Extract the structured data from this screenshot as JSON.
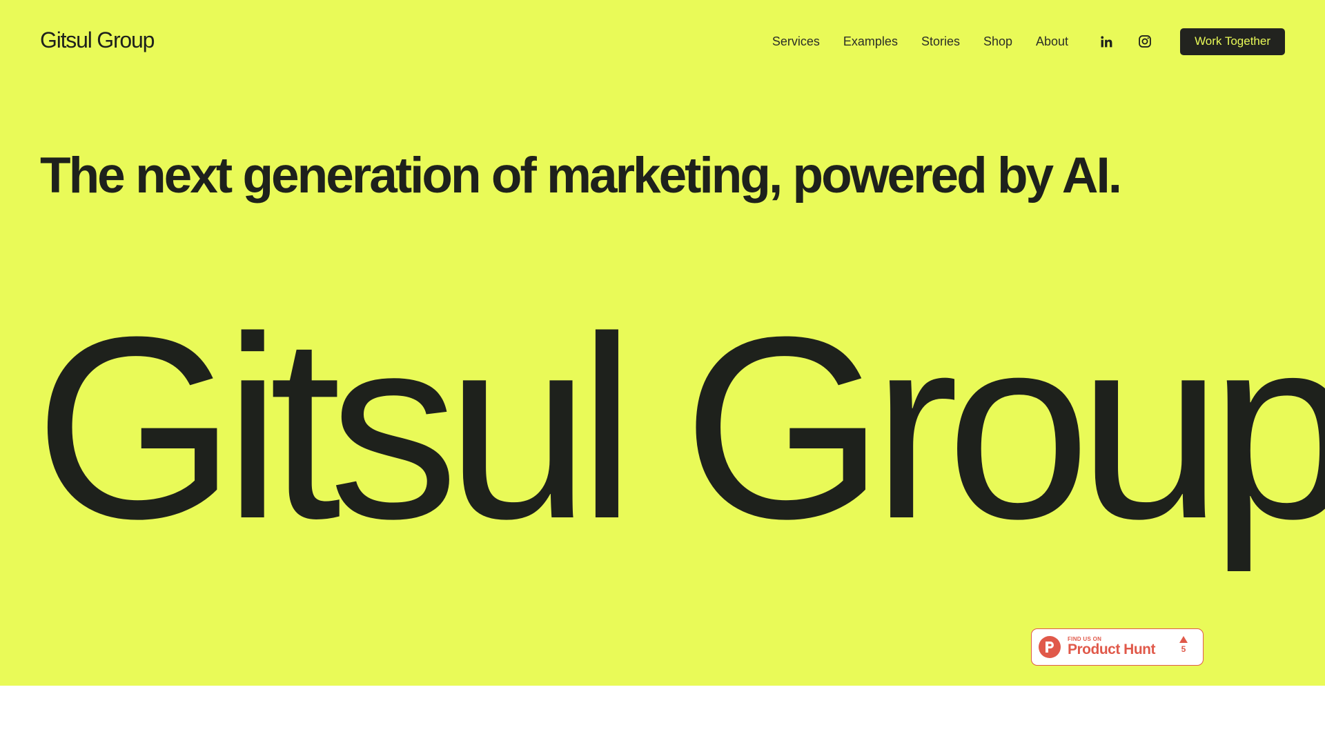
{
  "header": {
    "logo_text": "Gitsul Group",
    "nav": [
      {
        "label": "Services"
      },
      {
        "label": "Examples"
      },
      {
        "label": "Stories"
      },
      {
        "label": "Shop"
      },
      {
        "label": "About"
      }
    ],
    "social_icons": [
      "linkedin-icon",
      "instagram-icon"
    ],
    "cta_label": "Work Together"
  },
  "hero": {
    "tagline": "The next generation of marketing, powered by AI.",
    "big_title": "Gitsul Group"
  },
  "product_hunt_badge": {
    "small_text": "FIND US ON",
    "name": "Product Hunt",
    "votes": "5"
  },
  "colors": {
    "hero_background": "#e9fa58",
    "text": "#1e211c",
    "cta_background": "#22231f",
    "cta_text": "#e9fa58",
    "product_hunt": "#e0594a"
  }
}
